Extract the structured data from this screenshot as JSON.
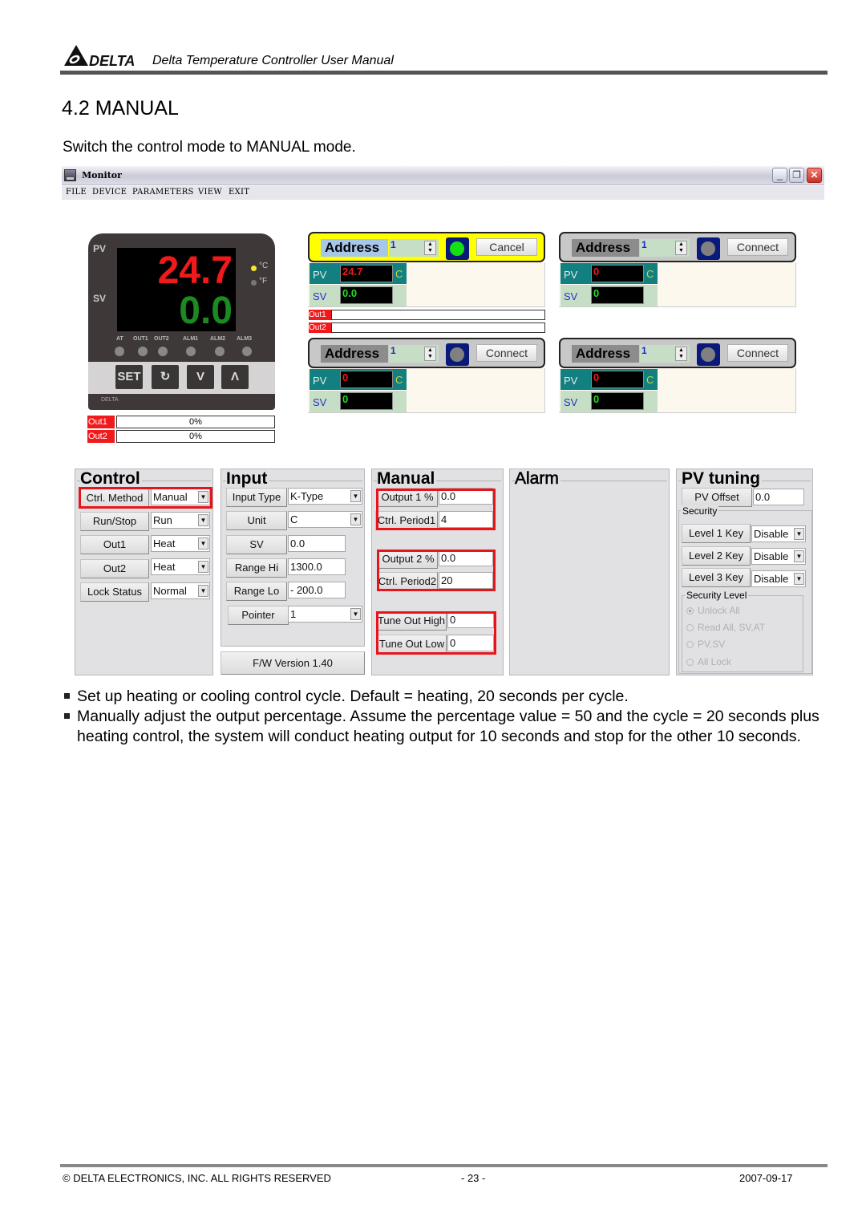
{
  "header": {
    "brand": "DELTA",
    "title": "Delta Temperature Controller User Manual"
  },
  "section": {
    "title": "4.2 MANUAL",
    "intro": "Switch the control mode to MANUAL mode."
  },
  "window": {
    "title": "Monitor",
    "menu": [
      "FILE",
      "DEVICE",
      "PARAMETERS",
      "VIEW",
      "EXIT"
    ],
    "controls": {
      "minimize": "_",
      "restore": "❐",
      "close": "✕"
    }
  },
  "device": {
    "pv_label": "PV",
    "sv_label": "SV",
    "pv_value": "24.7",
    "sv_value": "0.0",
    "unit_c": "°C",
    "unit_f": "°F",
    "unit_c_active": true,
    "leds": [
      "AT",
      "OUT1",
      "OUT2",
      "ALM1",
      "ALM2",
      "ALM3"
    ],
    "keys": [
      "SET",
      "↻",
      "V",
      "Λ"
    ],
    "brand": "DELTA",
    "outputs": [
      {
        "label": "Out1",
        "value": "0%"
      },
      {
        "label": "Out2",
        "value": "0%"
      }
    ],
    "colors": {
      "pv": "#f0191b",
      "sv": "#1a8a22"
    }
  },
  "monitors": [
    {
      "state": "active",
      "address_label": "Address",
      "address": "1",
      "button": "Cancel",
      "led_color": "#14e014",
      "pv_label": "PV",
      "pv": "24.7",
      "unit": "C",
      "sv_label": "SV",
      "sv": "0.0",
      "outputs": [
        "Out1",
        "Out2"
      ]
    },
    {
      "state": "idle",
      "address_label": "Address",
      "address": "1",
      "button": "Connect",
      "led_color": "#808080",
      "pv_label": "PV",
      "pv": "0",
      "unit": "C",
      "sv_label": "SV",
      "sv": "0"
    },
    {
      "state": "idle",
      "address_label": "Address",
      "address": "1",
      "button": "Connect",
      "led_color": "#808080",
      "pv_label": "PV",
      "pv": "0",
      "unit": "C",
      "sv_label": "SV",
      "sv": "0"
    },
    {
      "state": "idle",
      "address_label": "Address",
      "address": "1",
      "button": "Connect",
      "led_color": "#808080",
      "pv_label": "PV",
      "pv": "0",
      "unit": "C",
      "sv_label": "SV",
      "sv": "0"
    }
  ],
  "control": {
    "title": "Control",
    "rows": [
      {
        "label": "Ctrl. Method",
        "value": "Manual",
        "highlighted": true
      },
      {
        "label": "Run/Stop",
        "value": "Run"
      },
      {
        "label": "Out1",
        "value": "Heat"
      },
      {
        "label": "Out2",
        "value": "Heat"
      },
      {
        "label": "Lock Status",
        "value": "Normal"
      }
    ]
  },
  "input": {
    "title": "Input",
    "rows": [
      {
        "label": "Input Type",
        "value": "K-Type",
        "dropdown": true
      },
      {
        "label": "Unit",
        "value": "C",
        "dropdown": true
      },
      {
        "label": "SV",
        "value": "0.0"
      },
      {
        "label": "Range Hi",
        "value": "1300.0"
      },
      {
        "label": "Range Lo",
        "value": "- 200.0"
      },
      {
        "label": "Pointer",
        "value": "1",
        "dropdown": true
      }
    ],
    "fw_version": "F/W Version 1.40"
  },
  "manual": {
    "title": "Manual",
    "rows": [
      {
        "label": "Output 1 %",
        "value": "0.0"
      },
      {
        "label": "Ctrl. Period1",
        "value": "4"
      },
      {
        "label": "Output 2 %",
        "value": "0.0"
      },
      {
        "label": "Ctrl. Period2",
        "value": "20"
      },
      {
        "label": "Tune Out High",
        "value": "0"
      },
      {
        "label": "Tune Out Low",
        "value": "0"
      }
    ]
  },
  "alarm": {
    "title": "Alarm"
  },
  "pv_tuning": {
    "title": "PV tuning",
    "offset_label": "PV Offset",
    "offset_value": "0.0",
    "security_title": "Security",
    "keys": [
      {
        "label": "Level 1 Key",
        "value": "Disable"
      },
      {
        "label": "Level 2 Key",
        "value": "Disable"
      },
      {
        "label": "Level 3 Key",
        "value": "Disable"
      }
    ],
    "security_level_title": "Security Level",
    "security_levels": [
      {
        "label": "Unlock All",
        "selected": true
      },
      {
        "label": "Read All, SV,AT",
        "selected": false
      },
      {
        "label": "PV,SV",
        "selected": false
      },
      {
        "label": "All Lock",
        "selected": false
      }
    ]
  },
  "bullets": [
    "Set up heating or cooling control cycle. Default = heating, 20 seconds per cycle.",
    "Manually adjust the output percentage. Assume the percentage value = 50 and the cycle = 20 seconds plus heating control, the system will conduct heating output for 10 seconds and stop for the other 10 seconds."
  ],
  "footer": {
    "copyright": "© DELTA ELECTRONICS, INC. ALL RIGHTS RESERVED",
    "page": "- 23 -",
    "date": "2007-09-17"
  }
}
